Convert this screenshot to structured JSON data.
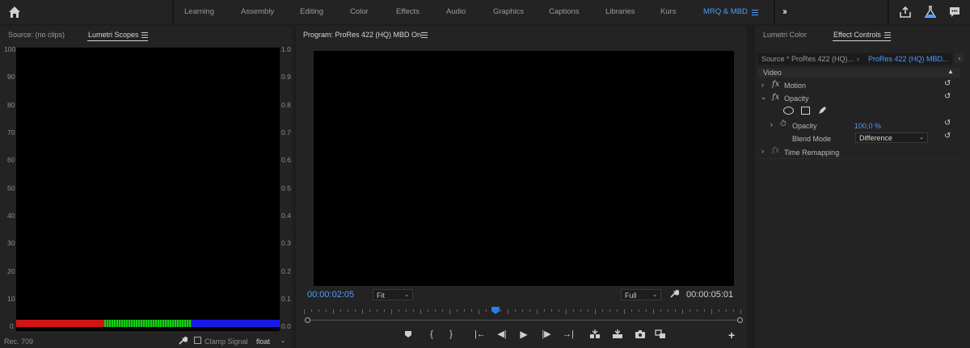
{
  "workspaces": {
    "tabs": [
      "Learning",
      "Assembly",
      "Editing",
      "Color",
      "Effects",
      "Audio",
      "Graphics",
      "Captions",
      "Libraries",
      "Kurs",
      "MRQ & MBD"
    ],
    "active": "MRQ & MBD",
    "icons": [
      "home-icon",
      "more-workspaces-icon",
      "share-icon",
      "beta-flask-icon",
      "feedback-icon"
    ]
  },
  "source_panel": {
    "tab_source": "Source: (no clips)",
    "tab_scopes": "Lumetri Scopes",
    "scale_left": [
      "100",
      "90",
      "80",
      "70",
      "60",
      "50",
      "40",
      "30",
      "20",
      "10",
      "0"
    ],
    "scale_right": [
      "1.0",
      "0.9",
      "0.8",
      "0.7",
      "0.6",
      "0.5",
      "0.4",
      "0.3",
      "0.2",
      "0.1",
      "0.0"
    ],
    "colorspace": "Rec. 709",
    "clamp_label": "Clamp Signal",
    "precision": "float",
    "colors": {
      "red": "#d21414",
      "green": "#17d317",
      "blue": "#1a1ae6"
    }
  },
  "program": {
    "title": "Program: ProRes 422 (HQ) MBD On",
    "timecode_current": "00:00:02:05",
    "zoom": "Fit",
    "resolution": "Full",
    "timecode_duration": "00:00:05:01",
    "accent": "#4c9cff"
  },
  "effects": {
    "tab_color": "Lumetri Color",
    "tab_effect_controls": "Effect Controls",
    "source_label": "Source * ProRes 422 (HQ)...",
    "sequence_label": "ProRes 422 (HQ) MBD...",
    "section": "Video",
    "motion": "Motion",
    "opacity_group": "Opacity",
    "opacity_label": "Opacity",
    "opacity_value": "100,0 %",
    "blend_label": "Blend Mode",
    "blend_value": "Difference",
    "time_remap": "Time Remapping",
    "fx": "fx"
  }
}
